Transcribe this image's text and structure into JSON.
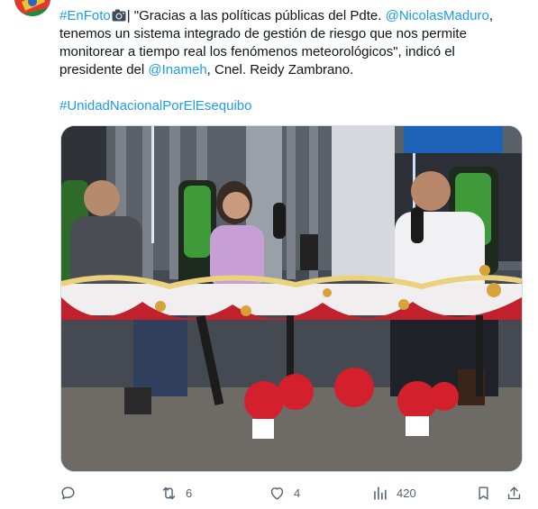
{
  "tweet": {
    "hashtag_enfoto": "#EnFoto",
    "text_part1": "| \"Gracias a las políticas públicas del Pdte. ",
    "mention_maduro": "@NicolasMaduro",
    "text_part2": ", tenemos un sistema integrado de gestión de riesgo que nos permite monitorear a tiempo real los fenómenos meteorológicos\", indicó el presidente del ",
    "mention_inameh": "@Inameh",
    "text_part3": ", Cnel. Reidy Zambrano.",
    "hashtag_esequibo": "#UnidadNacionalPorElEsequibo"
  },
  "colors": {
    "link": "#1d9bf0",
    "text": "#0f1419",
    "muted": "#536471"
  },
  "actions": {
    "reply_count": "",
    "retweet_count": "6",
    "like_count": "4",
    "views_count": "420"
  },
  "icons": {
    "reply": "speech-bubble-icon",
    "retweet": "retweet-arrows-icon",
    "like": "heart-icon",
    "views": "bar-chart-icon",
    "bookmark": "bookmark-icon",
    "share": "share-upload-icon",
    "camera": "camera-emoji-icon"
  }
}
